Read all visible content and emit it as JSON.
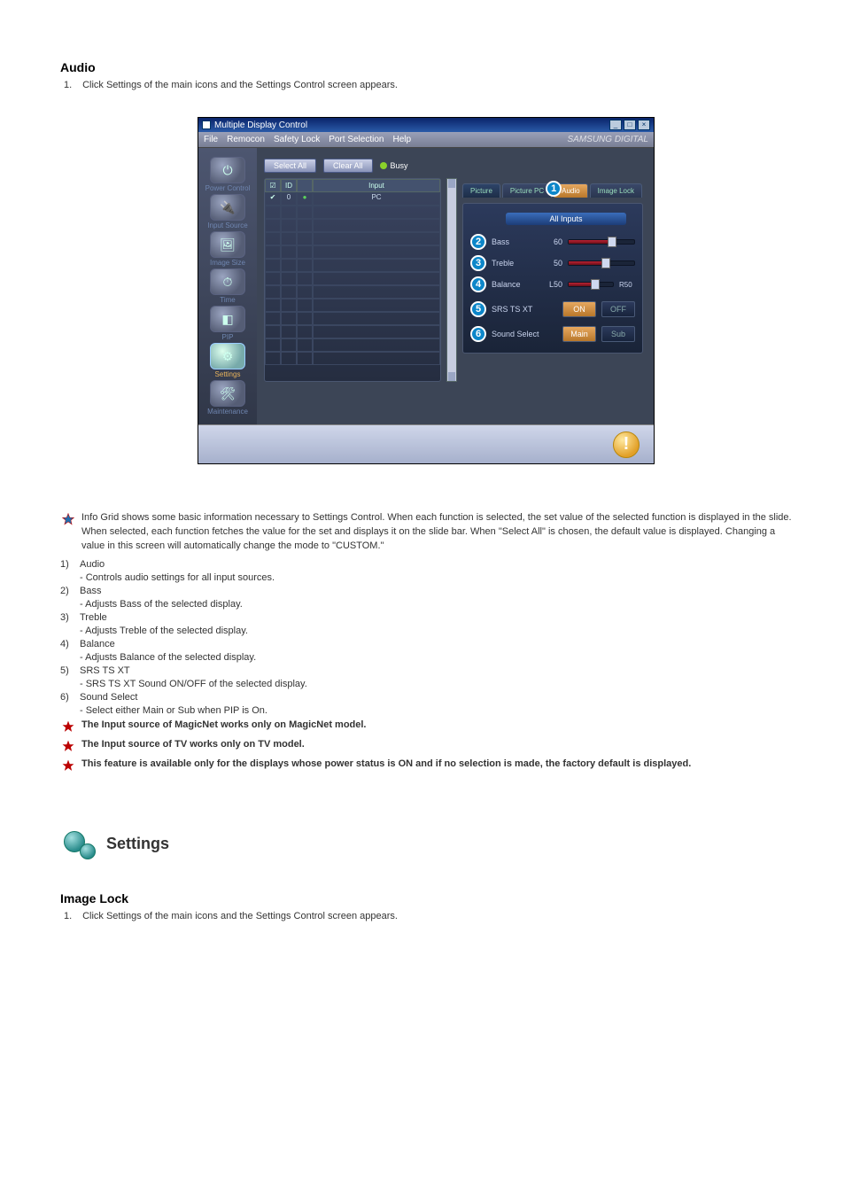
{
  "section1": {
    "title": "Audio"
  },
  "instruction1": {
    "num": "1.",
    "text": "Click Settings of the main icons and the Settings Control screen appears."
  },
  "app": {
    "window_title": "Multiple Display Control",
    "menubar": [
      "File",
      "Remocon",
      "Safety Lock",
      "Port Selection",
      "Help"
    ],
    "brand": "SAMSUNG DIGITAL",
    "sidebar": [
      {
        "label": "Power Control",
        "glyph": "⏻"
      },
      {
        "label": "Input Source",
        "glyph": "🔌"
      },
      {
        "label": "Image Size",
        "glyph": "🖼"
      },
      {
        "label": "Time",
        "glyph": "⏱"
      },
      {
        "label": "PIP",
        "glyph": "◧"
      },
      {
        "label": "Settings",
        "glyph": "⚙"
      },
      {
        "label": "Maintenance",
        "glyph": "🛠"
      }
    ],
    "toprow": {
      "select_all": "Select All",
      "clear_all": "Clear All",
      "busy": "Busy"
    },
    "grid": {
      "headers": [
        "☑",
        "ID",
        "",
        "Input"
      ],
      "row1": {
        "id": "0",
        "stat": "●",
        "input": "PC"
      }
    },
    "tabs": {
      "picture": "Picture",
      "picture_pc": "Picture PC",
      "audio": "Audio",
      "image_lock": "Image Lock",
      "badge": "1"
    },
    "all_inputs": "All Inputs",
    "sliders": [
      {
        "badge": "2",
        "label": "Bass",
        "value": "60",
        "fill": 60
      },
      {
        "badge": "3",
        "label": "Treble",
        "value": "50",
        "fill": 50
      },
      {
        "badge": "4",
        "label": "Balance",
        "value": "L50",
        "fill": 50,
        "left": "",
        "right": "R50"
      }
    ],
    "opts": [
      {
        "badge": "5",
        "label": "SRS TS XT",
        "a": "ON",
        "b": "OFF",
        "sel": "a"
      },
      {
        "badge": "6",
        "label": "Sound Select",
        "a": "Main",
        "b": "Sub",
        "sel": "a"
      }
    ]
  },
  "notes": {
    "infoGrid": "Info Grid shows some basic information necessary to Settings Control. When each function is selected, the set value of the selected function is displayed in the slide. When selected, each function fetches the value for the set and displays it on the slide bar. When \"Select All\" is chosen, the default value is displayed. Changing a value in this screen will automatically change the mode to \"CUSTOM.\"",
    "items": [
      {
        "n": "1)",
        "t": "Audio",
        "d": "- Controls audio settings for all input sources."
      },
      {
        "n": "2)",
        "t": "Bass",
        "d": "- Adjusts Bass of the selected display."
      },
      {
        "n": "3)",
        "t": "Treble",
        "d": "- Adjusts Treble of the selected display."
      },
      {
        "n": "4)",
        "t": "Balance",
        "d": "- Adjusts Balance of the selected display."
      },
      {
        "n": "5)",
        "t": "SRS TS XT",
        "d": "- SRS TS XT Sound ON/OFF of the selected display."
      },
      {
        "n": "6)",
        "t": "Sound Select",
        "d": "- Select either Main or Sub when PIP is On."
      }
    ],
    "warn1": "The Input source of MagicNet works only on MagicNet model.",
    "warn2": "The Input source of TV works only on TV model.",
    "warn3": "This feature is available only for the displays whose power status is ON and if no selection is made, the factory default is displayed."
  },
  "settings_heading": "Settings",
  "section2": {
    "title": "Image Lock"
  },
  "instruction2": {
    "num": "1.",
    "text": "Click Settings of the main icons and the Settings Control screen appears."
  }
}
